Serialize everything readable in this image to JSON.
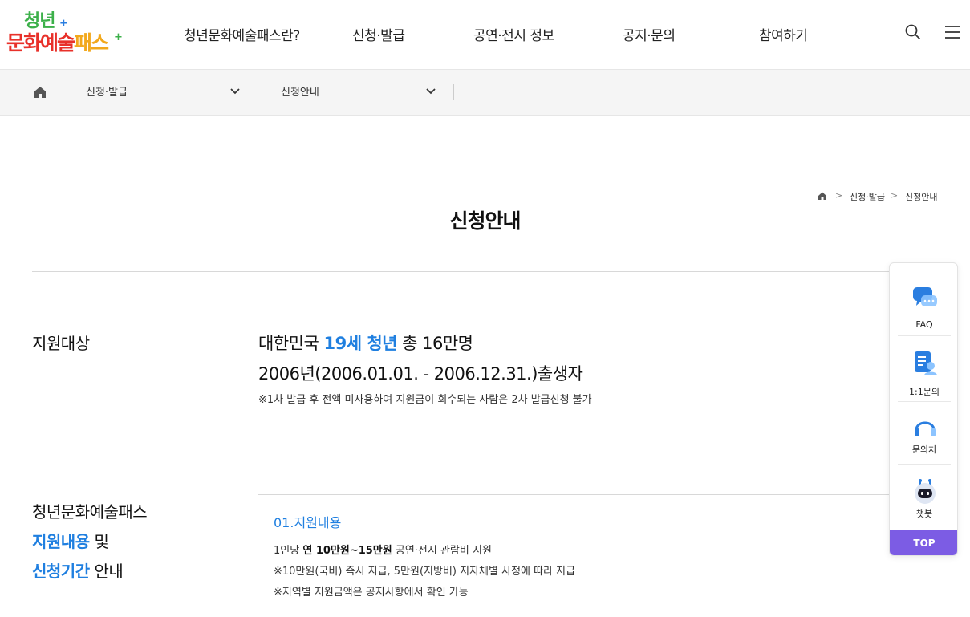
{
  "logo": {
    "line1": "청년",
    "line2a": "문화예술",
    "line2b": "패스",
    "plus": "+"
  },
  "nav": {
    "items": [
      {
        "label": "청년문화예술패스란?"
      },
      {
        "label": "신청·발급"
      },
      {
        "label": "공연·전시 정보"
      },
      {
        "label": "공지·문의"
      },
      {
        "label": "참여하기"
      }
    ],
    "search_icon": "search-icon",
    "menu_icon": "hamburger-menu-icon"
  },
  "breadcrumb_bar": {
    "home_icon": "home-icon",
    "level1": "신청·발급",
    "level2": "신청안내"
  },
  "mini_breadcrumb": {
    "level1": "신청·발급",
    "level2": "신청안내"
  },
  "page_title": "신청안내",
  "target": {
    "label": "지원대상",
    "line1_pre": "대한민국 ",
    "line1_hl": "19세 청년",
    "line1_post": " 총 16만명",
    "line2": "2006년(2006.01.01. - 2006.12.31.)출생자",
    "note": "※1차 발급 후 전액 미사용하여 지원금이 회수되는 사람은 2차 발급신청 불가"
  },
  "support": {
    "label_line1": "청년문화예술패스",
    "label_line2_blue": "지원내용",
    "label_line2_rest": " 및",
    "label_line3_blue": "신청기간",
    "label_line3_rest": " 안내",
    "sub_title": "01.지원내용",
    "desc1_pre": "1인당 ",
    "desc1_bold": "연 10만원~15만원",
    "desc1_post": " 공연·전시 관람비 지원",
    "desc2": "※10만원(국비) 즉시 지급, 5만원(지방비) 지자체별 사정에 따라 지급",
    "desc3": "※지역별 지원금액은 공지사항에서 확인 가능"
  },
  "side_panel": {
    "items": [
      {
        "label": "FAQ",
        "icon": "chat-bubble-icon"
      },
      {
        "label": "1:1문의",
        "icon": "document-person-icon"
      },
      {
        "label": "문의처",
        "icon": "headset-icon"
      },
      {
        "label": "챗봇",
        "icon": "robot-icon"
      }
    ],
    "top_label": "TOP"
  },
  "colors": {
    "accent_blue": "#1f7fe0",
    "top_button": "#7c5ce4",
    "crumb_bg": "#f5f5f5"
  }
}
